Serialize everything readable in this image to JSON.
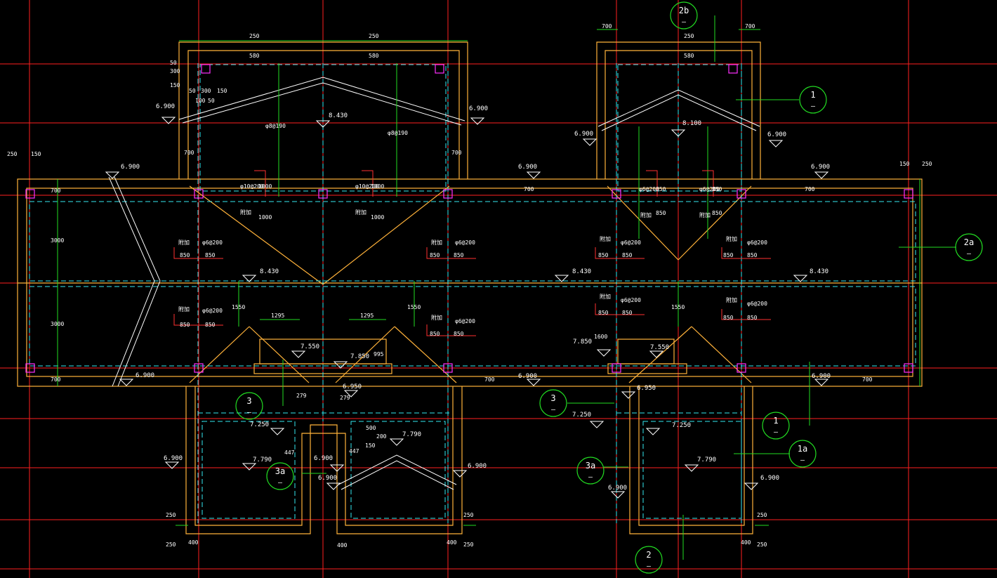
{
  "drawing": {
    "colors": {
      "background": "#000000",
      "grid": "#ff1f1f",
      "wall": "#ffb23a",
      "beam": "#34e7ef",
      "dimension": "#22dd22",
      "label": "#ffffff",
      "marker": "#ff2fff",
      "rebar": "#ff3030"
    },
    "callouts": [
      {
        "top": "2b",
        "bottom": "—"
      },
      {
        "top": "1",
        "bottom": "—"
      },
      {
        "top": "2a",
        "bottom": "—"
      },
      {
        "top": "3",
        "bottom": "—"
      },
      {
        "top": "3",
        "bottom": "—"
      },
      {
        "top": "1",
        "bottom": "—"
      },
      {
        "top": "1a",
        "bottom": "—"
      },
      {
        "top": "3a",
        "bottom": "—"
      },
      {
        "top": "3a",
        "bottom": "—"
      },
      {
        "top": "2",
        "bottom": "—"
      }
    ],
    "elevations": {
      "e6900": "6.900",
      "e8430": "8.430",
      "e8100": "8.100",
      "e7550": "7.550",
      "e7850": "7.850",
      "e6950": "6.950",
      "e7250": "7.250",
      "e7790": "7.790"
    },
    "dims": {
      "d250": "250",
      "d150": "150",
      "d700": "700",
      "d580": "580",
      "d300": "300",
      "d50": "50",
      "d100": "100",
      "d3000": "3000",
      "d1295": "1295",
      "d1550": "1550",
      "d279": "279",
      "d447": "447",
      "d400": "400",
      "d995": "995",
      "d1600": "1600",
      "d500": "500",
      "d1000": "1000",
      "d850": "850",
      "d200": "200"
    },
    "rebar": {
      "f8_190": "φ8@190",
      "f10_200": "φ10@200",
      "f6_200": "φ6@200",
      "reinf": "附加",
      "dim850": "850"
    }
  }
}
